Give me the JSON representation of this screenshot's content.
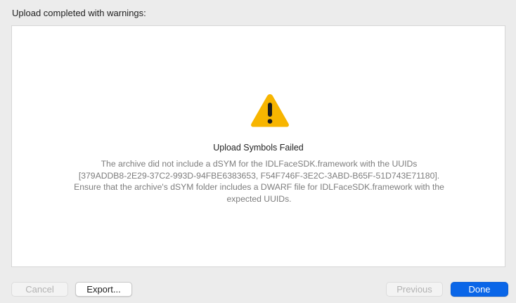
{
  "header": {
    "text": "Upload completed with warnings:"
  },
  "panel": {
    "icon": "warning-triangle-icon",
    "title": "Upload Symbols Failed",
    "message_lines": [
      "The archive did not include a dSYM for the IDLFaceSDK.framework with the UUIDs",
      "[379ADDB8-2E29-37C2-993D-94FBE6383653, F54F746F-3E2C-3ABD-B65F-51D743E71180].",
      "Ensure that the archive's dSYM folder includes a DWARF file for IDLFaceSDK.framework with the",
      "expected UUIDs."
    ]
  },
  "buttons": {
    "cancel": "Cancel",
    "export": "Export...",
    "previous": "Previous",
    "done": "Done"
  },
  "colors": {
    "warning": "#f7b500",
    "primary": "#0a66e8"
  }
}
